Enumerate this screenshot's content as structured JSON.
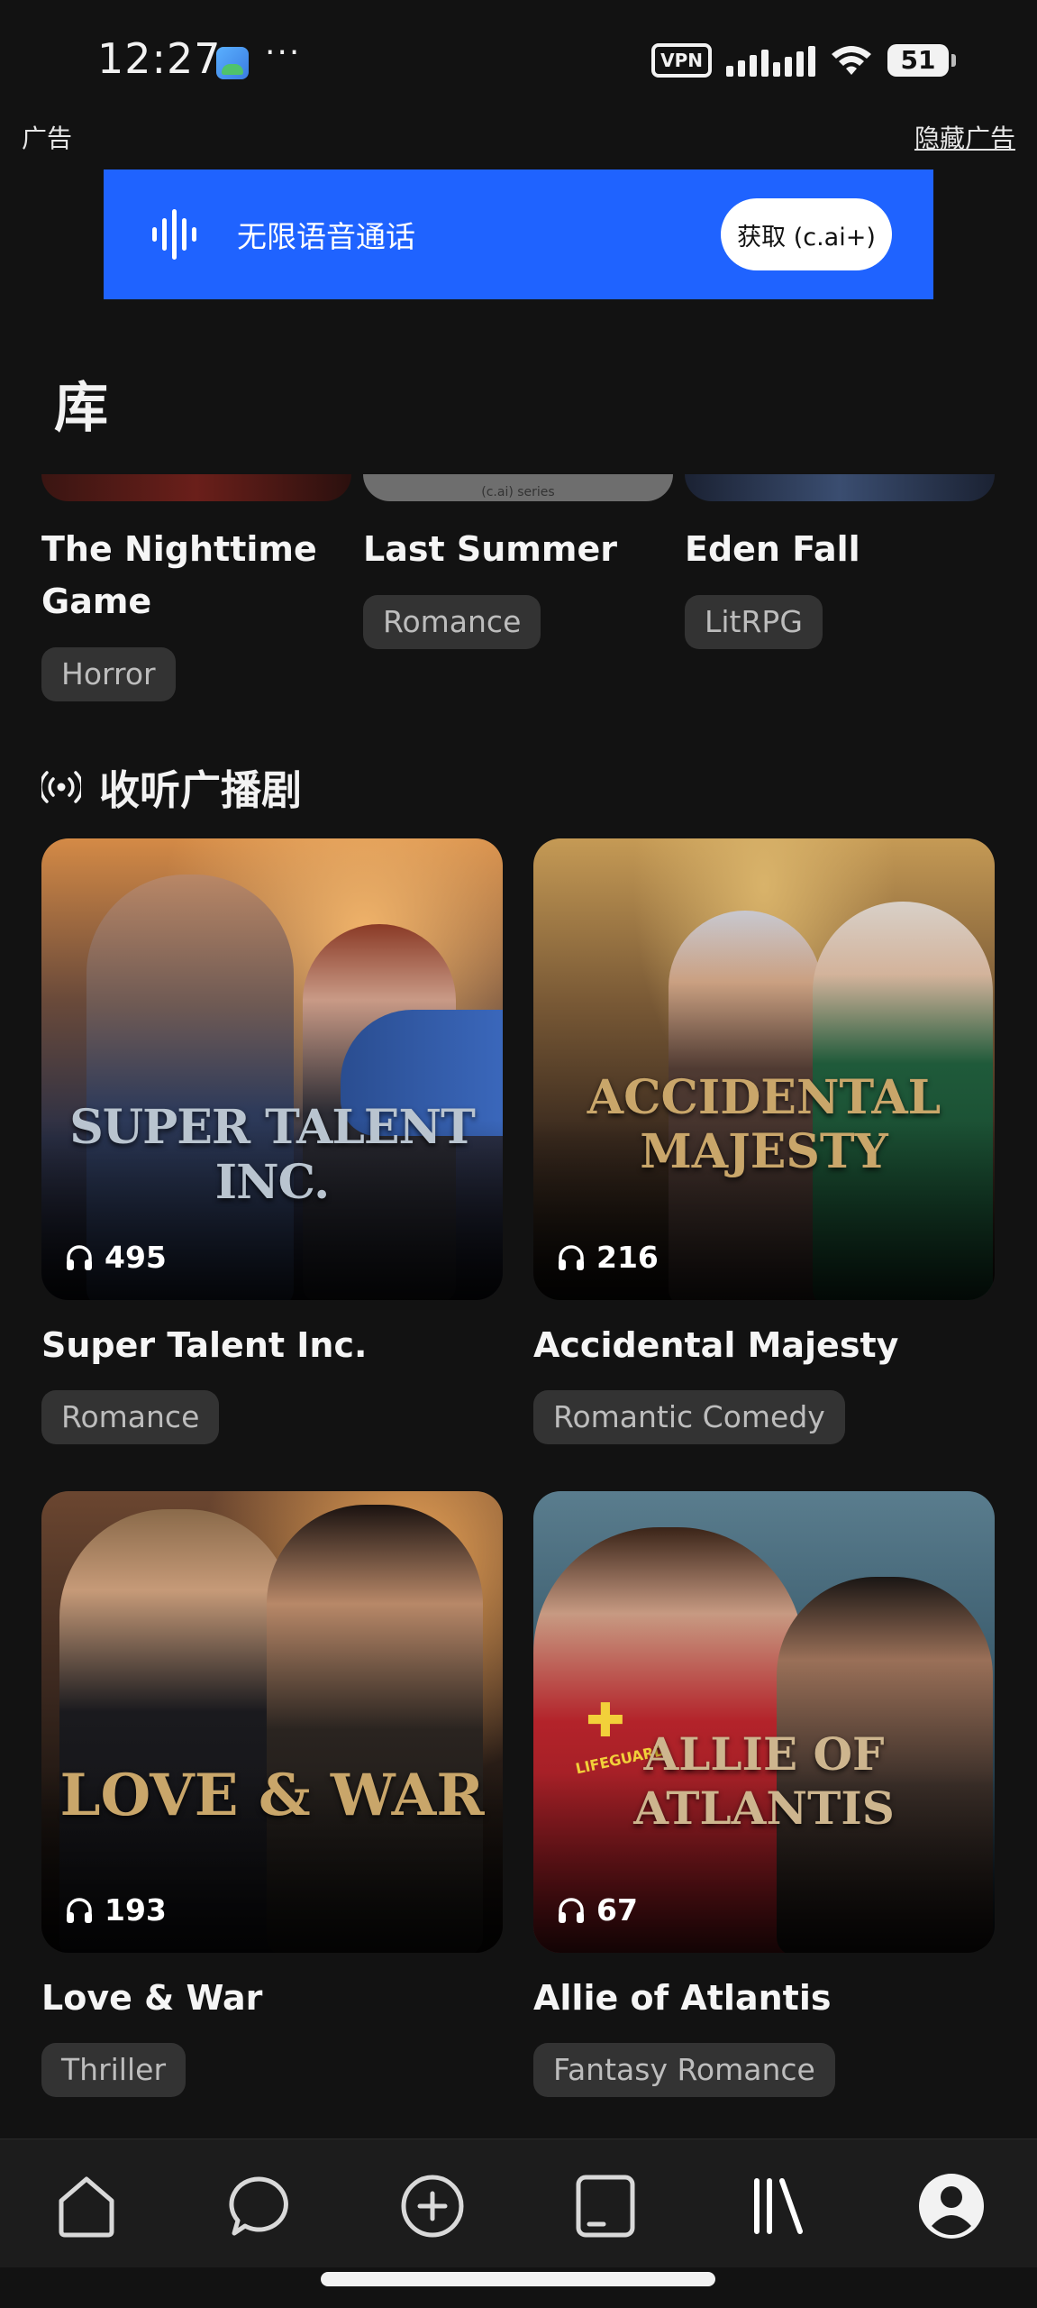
{
  "status": {
    "time": "12:27",
    "dots": "···",
    "vpn": "VPN",
    "battery": "51"
  },
  "ad": {
    "label": "广告",
    "hide": "隐藏广告",
    "text": "无限语音通话",
    "cta": "获取 (c.ai+)"
  },
  "page": {
    "title": "库"
  },
  "top_row": {
    "cover_caption": "(c.ai) series",
    "items": [
      {
        "title": "The Nighttime Game",
        "genre": "Horror"
      },
      {
        "title": "Last Summer",
        "genre": "Romance"
      },
      {
        "title": "Eden Fall",
        "genre": "LitRPG"
      }
    ]
  },
  "section": {
    "title": "收听广播剧",
    "icon": "broadcast-icon"
  },
  "dramas": [
    {
      "title": "Super Talent Inc.",
      "genre": "Romance",
      "plays": "495",
      "cover_text": "SUPER TALENT INC."
    },
    {
      "title": "Accidental Majesty",
      "genre": "Romantic Comedy",
      "plays": "216",
      "cover_text": "ACCIDENTAL MAJESTY"
    },
    {
      "title": "Love & War",
      "genre": "Thriller",
      "plays": "193",
      "cover_text": "LOVE & WAR"
    },
    {
      "title": "Allie of Atlantis",
      "genre": "Fantasy Romance",
      "plays": "67",
      "cover_text": "ALLIE OF ATLANTIS",
      "cover_badge": "LIFEGUARD"
    }
  ],
  "nav": [
    {
      "icon": "home-icon"
    },
    {
      "icon": "chat-icon"
    },
    {
      "icon": "create-icon"
    },
    {
      "icon": "feed-icon"
    },
    {
      "icon": "library-icon"
    },
    {
      "icon": "profile-icon"
    }
  ],
  "colors": {
    "background": "#121212",
    "ad_blue": "#1f63ff",
    "chip": "#333333",
    "nav": "#1c1c1c"
  }
}
